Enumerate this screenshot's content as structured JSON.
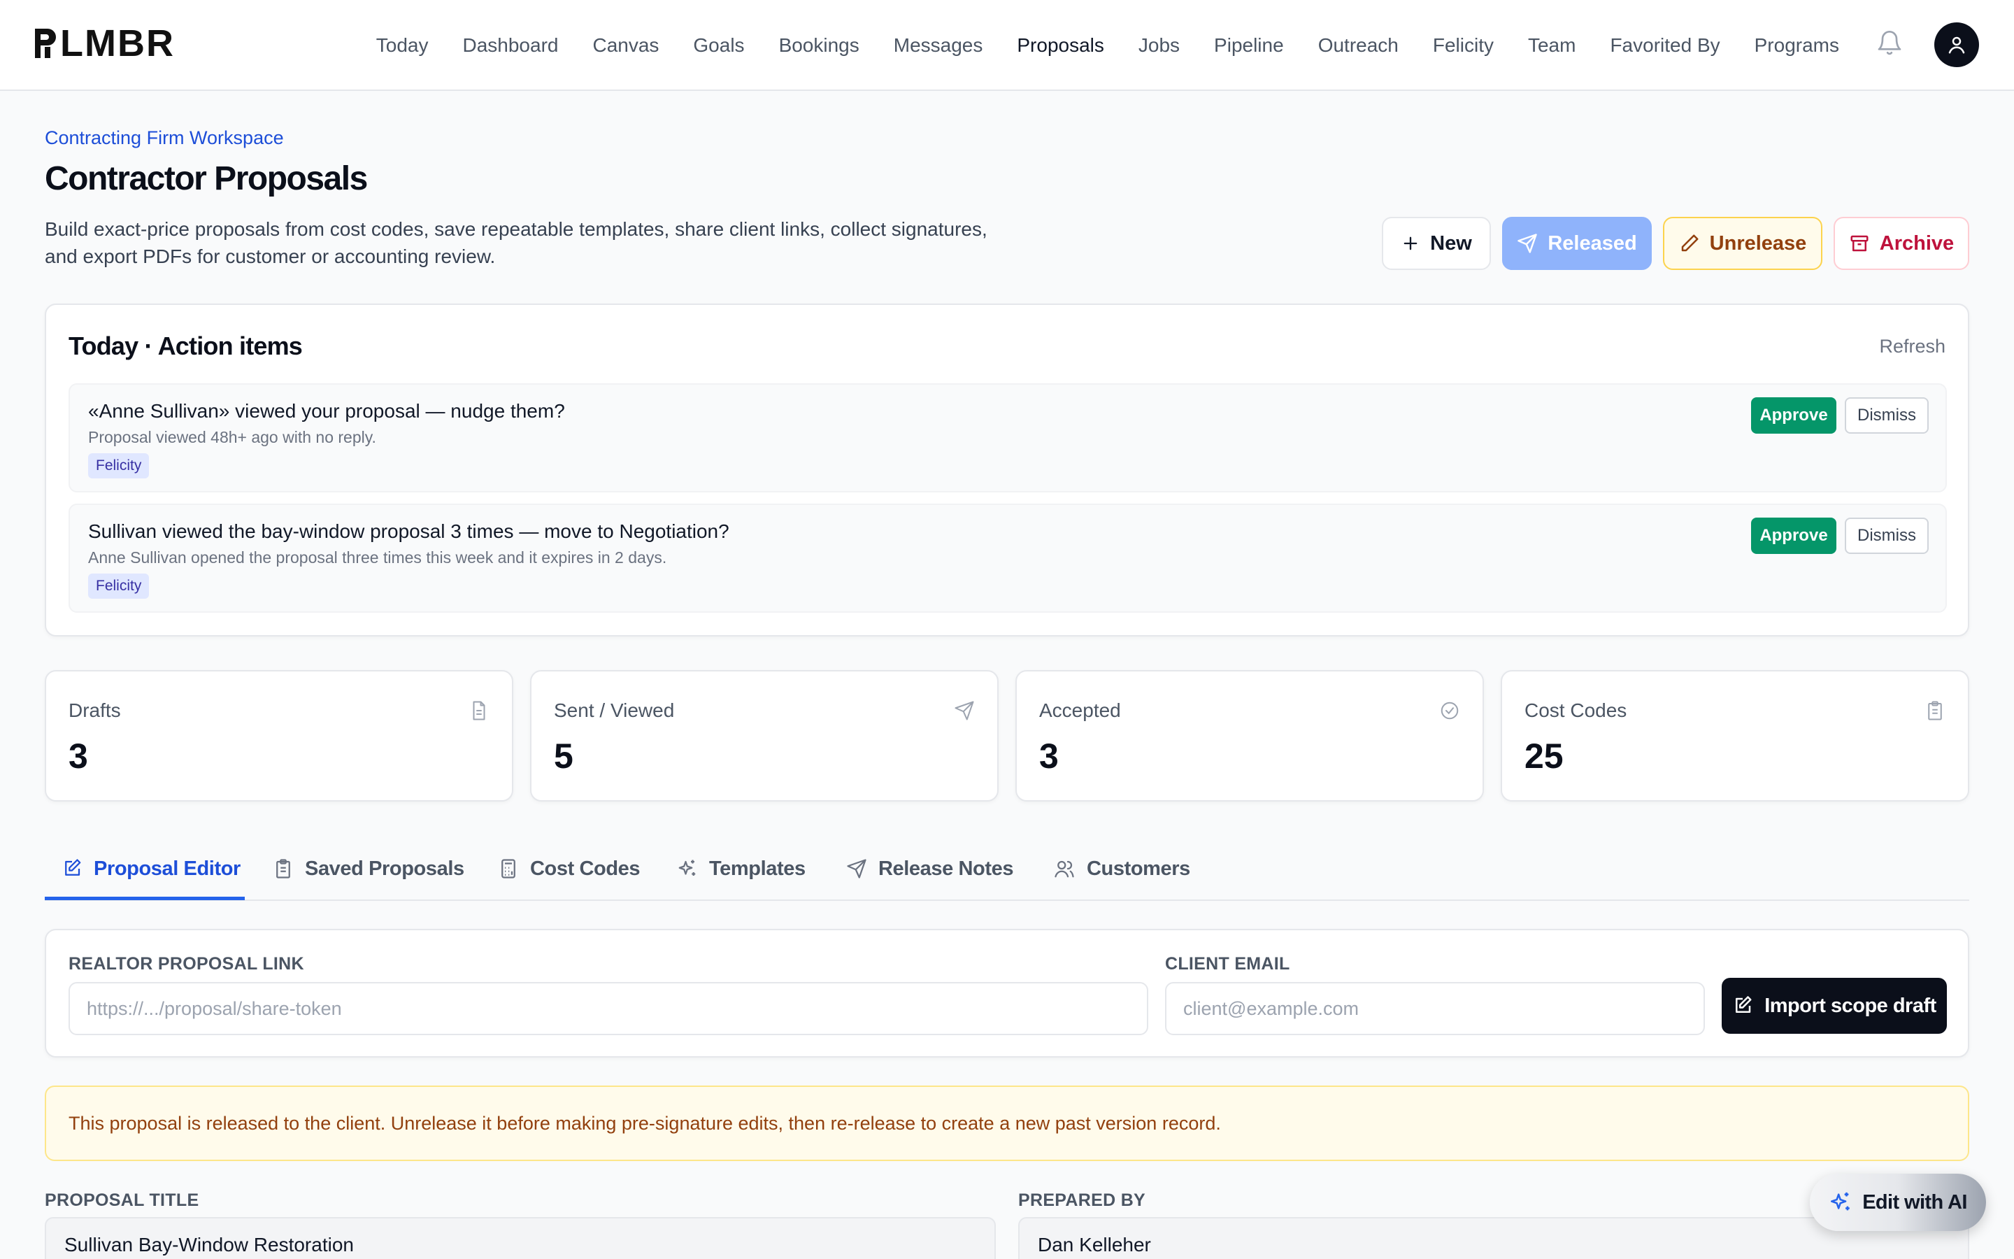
{
  "app": {
    "logo": "PLMBR"
  },
  "nav": {
    "items": [
      "Today",
      "Dashboard",
      "Canvas",
      "Goals",
      "Bookings",
      "Messages",
      "Proposals",
      "Jobs",
      "Pipeline",
      "Outreach",
      "Felicity",
      "Team",
      "Favorited By",
      "Programs"
    ],
    "active": "Proposals",
    "icons": [
      "bell-icon",
      "user-icon"
    ]
  },
  "header": {
    "breadcrumb": "Contracting Firm Workspace",
    "title": "Contractor Proposals",
    "description": "Build exact-price proposals from cost codes, save repeatable templates, share client links, collect signatures, and export PDFs for customer or accounting review.",
    "buttons": {
      "new": "New",
      "released": "Released",
      "unrelease": "Unrelease",
      "archive": "Archive"
    }
  },
  "action_items": {
    "title": "Today · Action items",
    "refresh": "Refresh",
    "items": [
      {
        "title": "«Anne Sullivan» viewed your proposal — nudge them?",
        "subtitle": "Proposal viewed 48h+ ago with no reply.",
        "tag": "Felicity",
        "approve": "Approve",
        "dismiss": "Dismiss"
      },
      {
        "title": "Sullivan viewed the bay-window proposal 3 times — move to Negotiation?",
        "subtitle": "Anne Sullivan opened the proposal three times this week and it expires in 2 days.",
        "tag": "Felicity",
        "approve": "Approve",
        "dismiss": "Dismiss"
      }
    ]
  },
  "stats": [
    {
      "label": "Drafts",
      "value": "3",
      "icon": "document-icon"
    },
    {
      "label": "Sent / Viewed",
      "value": "5",
      "icon": "send-icon"
    },
    {
      "label": "Accepted",
      "value": "3",
      "icon": "check-circle-icon"
    },
    {
      "label": "Cost Codes",
      "value": "25",
      "icon": "clipboard-icon"
    }
  ],
  "tabs": [
    {
      "label": "Proposal Editor",
      "icon": "edit-icon"
    },
    {
      "label": "Saved Proposals",
      "icon": "clipboard-icon"
    },
    {
      "label": "Cost Codes",
      "icon": "calculator-icon"
    },
    {
      "label": "Templates",
      "icon": "sparkle-icon"
    },
    {
      "label": "Release Notes",
      "icon": "send-icon"
    },
    {
      "label": "Customers",
      "icon": "users-icon"
    }
  ],
  "link_form": {
    "realtor_label": "Realtor Proposal Link",
    "realtor_placeholder": "https://.../proposal/share-token",
    "email_label": "Client Email",
    "email_placeholder": "client@example.com",
    "import_button": "Import scope draft"
  },
  "banner": "This proposal is released to the client. Unrelease it before making pre-signature edits, then re-release to create a new past version record.",
  "proposal": {
    "title_label": "PROPOSAL TITLE",
    "title_value": "Sullivan Bay-Window Restoration",
    "prepared_label": "PREPARED BY",
    "prepared_value": "Dan Kelleher"
  },
  "ai_fab": "Edit with AI",
  "colors": {
    "accent": "#2563eb",
    "approve": "#059669",
    "warning": "#92400e",
    "danger": "#be123c"
  }
}
